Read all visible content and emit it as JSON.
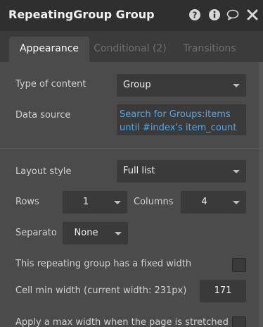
{
  "window": {
    "title": "RepeatingGroup Group",
    "icons": [
      "help-icon",
      "info-icon",
      "comment-icon",
      "close-icon"
    ]
  },
  "tabs": [
    {
      "label": "Appearance",
      "active": true
    },
    {
      "label": "Conditional (2)",
      "active": false
    },
    {
      "label": "Transitions",
      "active": false
    }
  ],
  "form": {
    "type_of_content": {
      "label": "Type of content",
      "value": "Group"
    },
    "data_source": {
      "label": "Data source",
      "line1": "Search for Groups:items",
      "line2": "until #index's item_count"
    },
    "layout_style": {
      "label": "Layout style",
      "value": "Full list"
    },
    "rows": {
      "label": "Rows",
      "value": "1"
    },
    "columns": {
      "label": "Columns",
      "value": "4"
    },
    "separator": {
      "label": "Separato",
      "value": "None"
    },
    "fixed_width": {
      "label": "This repeating group has a fixed width",
      "checked": false
    },
    "cell_min_width": {
      "label": "Cell min width (current width: 231px)",
      "value": "171"
    },
    "max_width": {
      "label": "Apply a max width when the page is stretched",
      "checked": false
    }
  },
  "colors": {
    "titlebar": "#2f2f2f",
    "panel": "#4b4b4b",
    "field": "#3a3a3a",
    "link": "#58a6e8"
  }
}
